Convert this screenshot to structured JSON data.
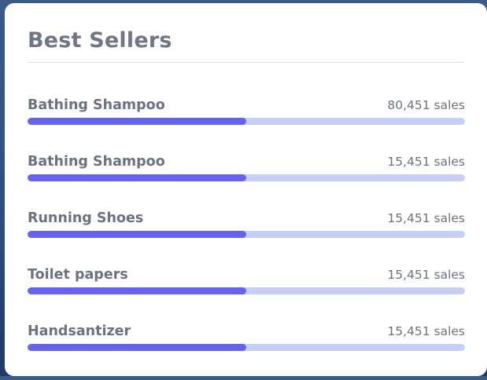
{
  "title": "Best Sellers",
  "accent_color": "#6463f4",
  "track_color": "#c7cff7",
  "items": [
    {
      "name": "Bathing Shampoo",
      "sales": "80,451 sales",
      "progress": 0.5
    },
    {
      "name": "Bathing Shampoo",
      "sales": "15,451 sales",
      "progress": 0.5
    },
    {
      "name": "Running Shoes",
      "sales": "15,451 sales",
      "progress": 0.5
    },
    {
      "name": "Toilet papers",
      "sales": "15,451 sales",
      "progress": 0.5
    },
    {
      "name": "Handsantizer",
      "sales": "15,451 sales",
      "progress": 0.5
    }
  ]
}
